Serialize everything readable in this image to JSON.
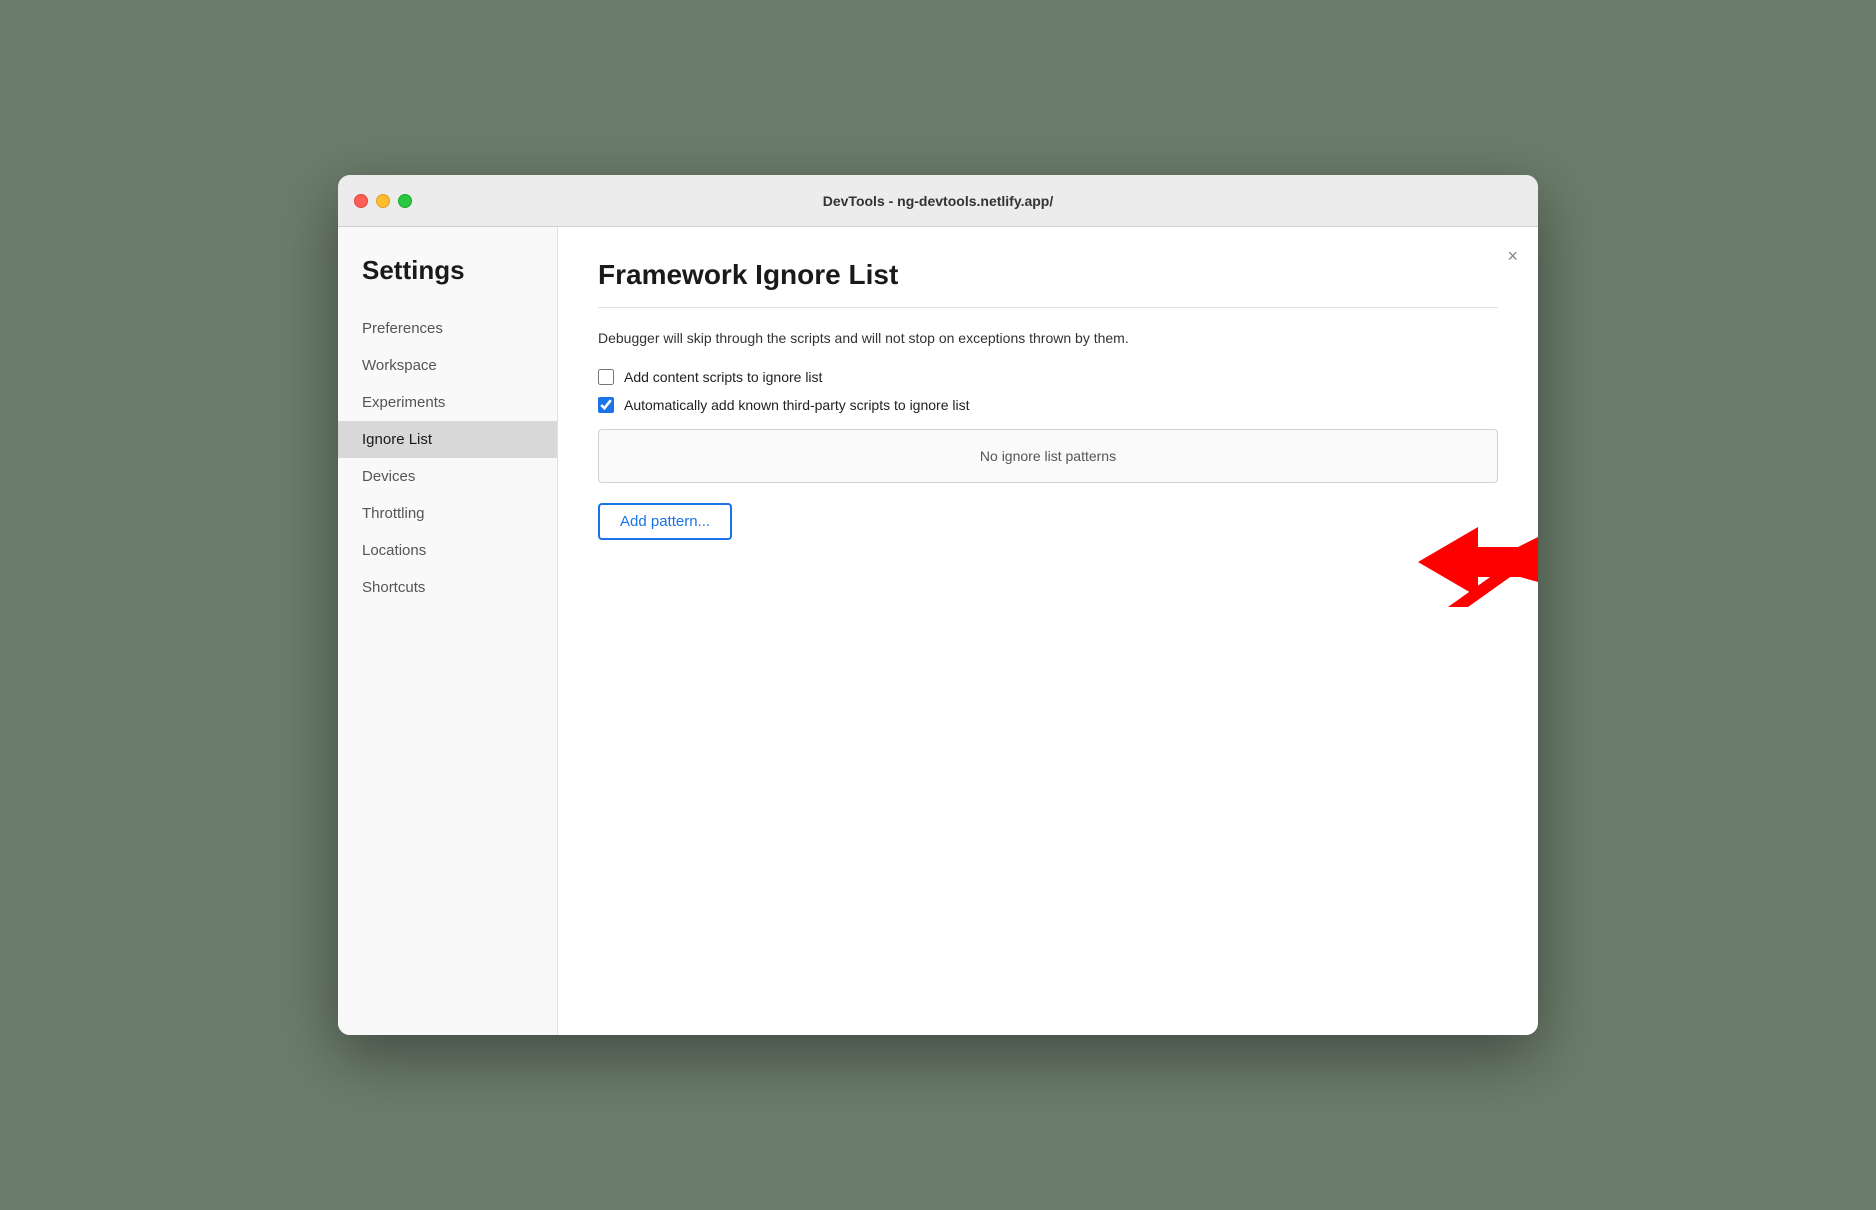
{
  "window": {
    "title": "DevTools - ng-devtools.netlify.app/"
  },
  "sidebar": {
    "title": "Settings",
    "items": [
      {
        "id": "preferences",
        "label": "Preferences",
        "active": false
      },
      {
        "id": "workspace",
        "label": "Workspace",
        "active": false
      },
      {
        "id": "experiments",
        "label": "Experiments",
        "active": false
      },
      {
        "id": "ignore-list",
        "label": "Ignore List",
        "active": true
      },
      {
        "id": "devices",
        "label": "Devices",
        "active": false
      },
      {
        "id": "throttling",
        "label": "Throttling",
        "active": false
      },
      {
        "id": "locations",
        "label": "Locations",
        "active": false
      },
      {
        "id": "shortcuts",
        "label": "Shortcuts",
        "active": false
      }
    ]
  },
  "main": {
    "title": "Framework Ignore List",
    "description": "Debugger will skip through the scripts and will not stop on exceptions thrown by them.",
    "checkboxes": [
      {
        "id": "add-content-scripts",
        "label": "Add content scripts to ignore list",
        "checked": false
      },
      {
        "id": "auto-add-third-party",
        "label": "Automatically add known third-party scripts to ignore list",
        "checked": true
      }
    ],
    "patterns_empty_label": "No ignore list patterns",
    "add_pattern_button": "Add pattern...",
    "close_button": "×"
  }
}
